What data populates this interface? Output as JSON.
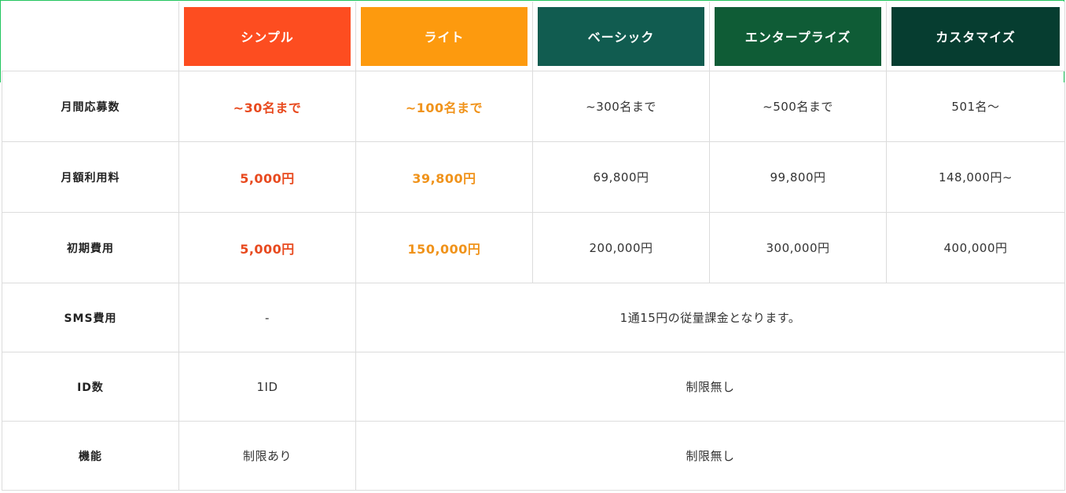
{
  "plans": [
    {
      "label": "シンプル",
      "color": "#fd4d20"
    },
    {
      "label": "ライト",
      "color": "#fd9a0e"
    },
    {
      "label": "ベーシック",
      "color": "#115c50"
    },
    {
      "label": "エンタープライズ",
      "color": "#0f5c36"
    },
    {
      "label": "カスタマイズ",
      "color": "#063d30"
    }
  ],
  "rows": {
    "applications": {
      "label": "月間応募数",
      "values": [
        "~30名まで",
        "~100名まで",
        "~300名まで",
        "~500名まで",
        "501名〜"
      ]
    },
    "monthly_fee": {
      "label": "月額利用料",
      "values": [
        "5,000円",
        "39,800円",
        "69,800円",
        "99,800円",
        "148,000円~"
      ]
    },
    "initial_fee": {
      "label": "初期費用",
      "values": [
        "5,000円",
        "150,000円",
        "200,000円",
        "300,000円",
        "400,000円"
      ]
    },
    "sms_fee": {
      "label": "SMS費用",
      "simple": "-",
      "others": "1通15円の従量課金となります。"
    },
    "id_count": {
      "label": "ID数",
      "simple": "1ID",
      "others": "制限無し"
    },
    "features": {
      "label": "機能",
      "simple": "制限あり",
      "others": "制限無し"
    }
  }
}
